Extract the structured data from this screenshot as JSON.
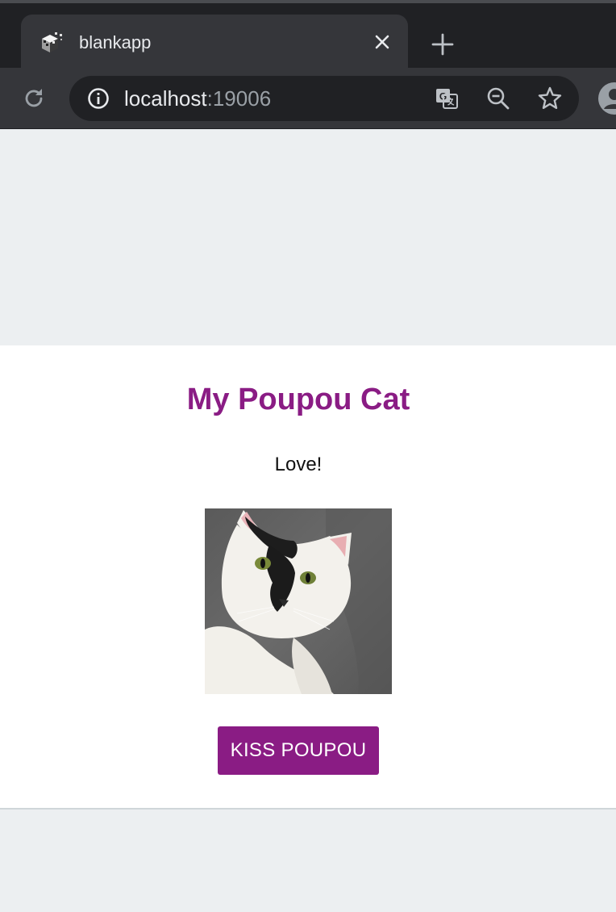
{
  "browser": {
    "tab_title": "blankapp",
    "url_host": "localhost",
    "url_port": ":19006",
    "icons": {
      "favicon": "app-favicon-icon",
      "tab_close": "close-icon",
      "new_tab": "plus-icon",
      "reload": "reload-icon",
      "site_info": "info-icon",
      "translate": "translate-icon",
      "zoom": "zoom-out-icon",
      "bookmark": "star-icon",
      "profile": "profile-icon"
    }
  },
  "app": {
    "title": "My Poupou Cat",
    "subtitle": "Love!",
    "button_label": "KISS POUPOU",
    "photo": "cat-photo"
  },
  "colors": {
    "accent": "#8a1c84",
    "page_background": "#eceff1",
    "card_background": "#ffffff",
    "chrome_dark": "#202124",
    "chrome_toolbar": "#35363a"
  }
}
